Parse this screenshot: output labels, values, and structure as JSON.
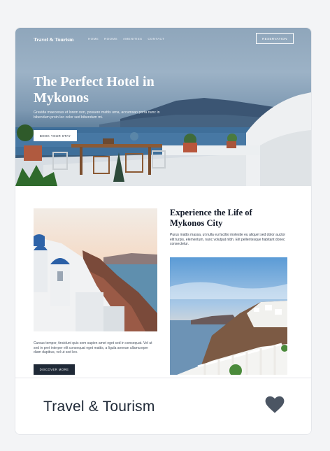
{
  "preview": {
    "brand": "Travel & Tourism",
    "nav": [
      "HOME",
      "ROOMS",
      "AMENITIES",
      "CONTACT"
    ],
    "reservation_label": "RESERVATION",
    "hero_title": "The Perfect Hotel in Mykonos",
    "hero_desc": "Gravida maecenas et lorem non, posuere mattis urna, accumsan porta nunc in bibendum proin leo color sed bibendum mi.",
    "book_label": "BOOK YOUR STAY",
    "section_title": "Experience the Life of Mykonos City",
    "section_text": "Purus mattis massa, ut nulla eu facilisi molestie eu aliquet sed dolor auctor elit turpis, elementum, nunc volutpat nibh. Elit pellentesque habitant donec consectetur.",
    "lorem_text": "Cursus tempor, tincidunt quis sem sapien amet eget sed in consequat. Vel ut sed in pret interper elit consequat eget mattis, a ligula aenean ullamcorper diam dapibus, vel ut sed leo.",
    "discover_label": "DISCOVER MORE"
  },
  "footer": {
    "title": "Travel & Tourism"
  },
  "colors": {
    "dark_button": "#1f2937",
    "heart": "#4b5563",
    "page_bg": "#f3f4f6"
  },
  "icons": {
    "favorite": "heart-icon"
  }
}
